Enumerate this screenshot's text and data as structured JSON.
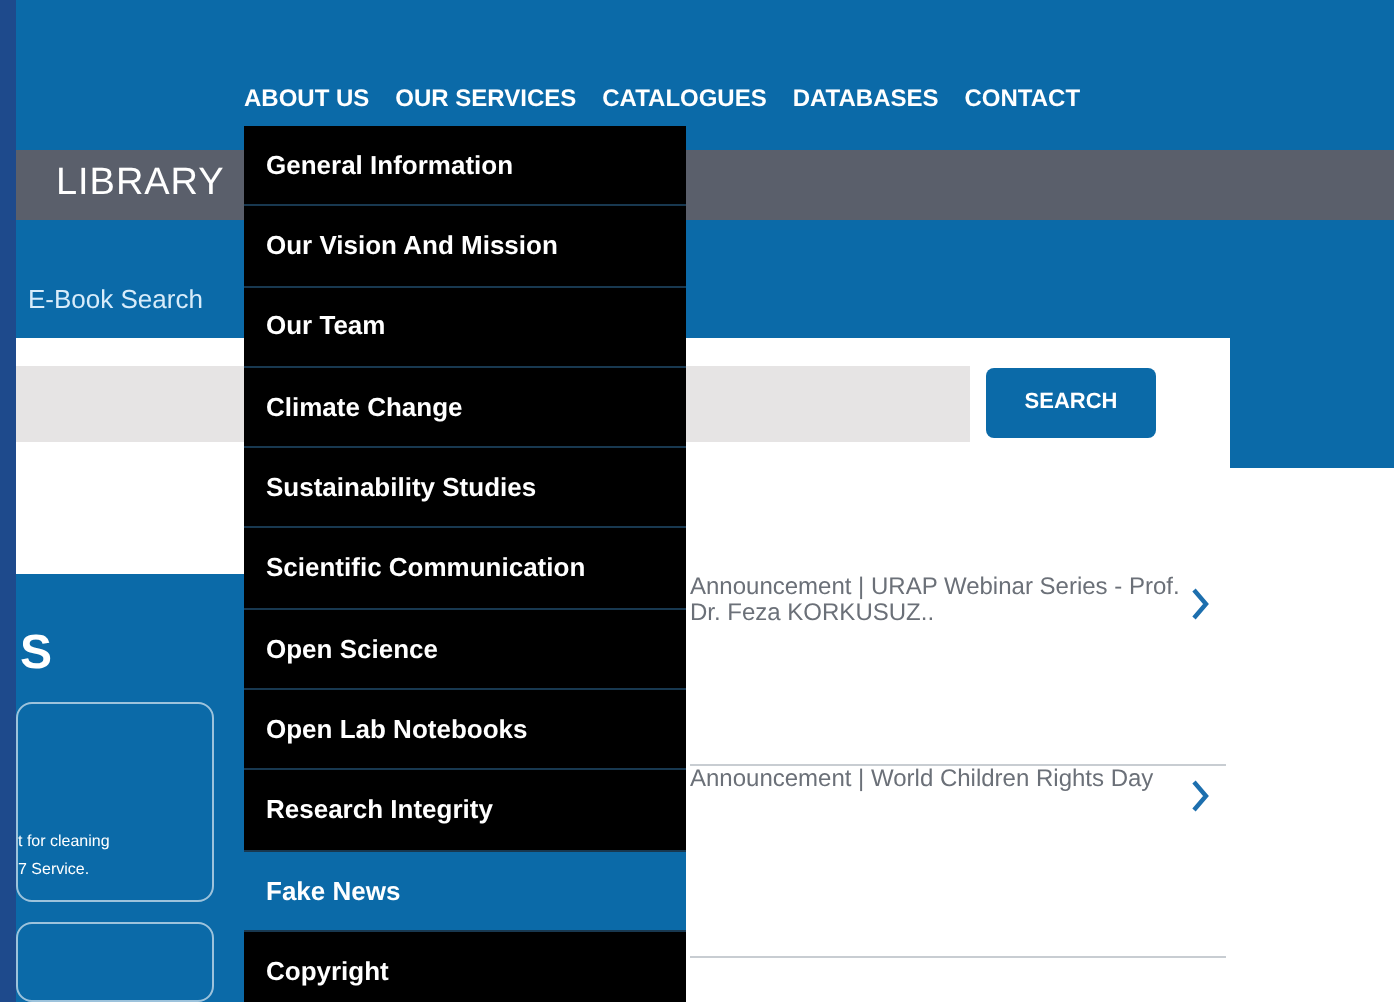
{
  "nav": [
    {
      "label": "ABOUT US"
    },
    {
      "label": "OUR SERVICES"
    },
    {
      "label": "CATALOGUES"
    },
    {
      "label": "DATABASES"
    },
    {
      "label": "CONTACT"
    }
  ],
  "banner": {
    "title": "LIBRARY"
  },
  "search": {
    "tab": "E-Book Search",
    "button": "SEARCH"
  },
  "dropdown": [
    {
      "label": "General Information",
      "selected": false
    },
    {
      "label": "Our Vision And Mission",
      "selected": false
    },
    {
      "label": "Our Team",
      "selected": false
    },
    {
      "label": "Climate Change",
      "selected": false
    },
    {
      "label": "Sustainability Studies",
      "selected": false
    },
    {
      "label": "Scientific Communication",
      "selected": false
    },
    {
      "label": "Open Science",
      "selected": false
    },
    {
      "label": "Open Lab Notebooks",
      "selected": false
    },
    {
      "label": "Research Integrity",
      "selected": false
    },
    {
      "label": "Fake News",
      "selected": true
    },
    {
      "label": "Copyright",
      "selected": false
    }
  ],
  "side_panel": {
    "heading": "S",
    "card_lines": [
      "t for cleaning",
      "7 Service."
    ]
  },
  "announcements": [
    {
      "title": "Announcement | URAP Webinar Series - Prof. Dr. Feza KORKUSUZ.."
    },
    {
      "title": "Announcement | World Children Rights Day"
    }
  ]
}
